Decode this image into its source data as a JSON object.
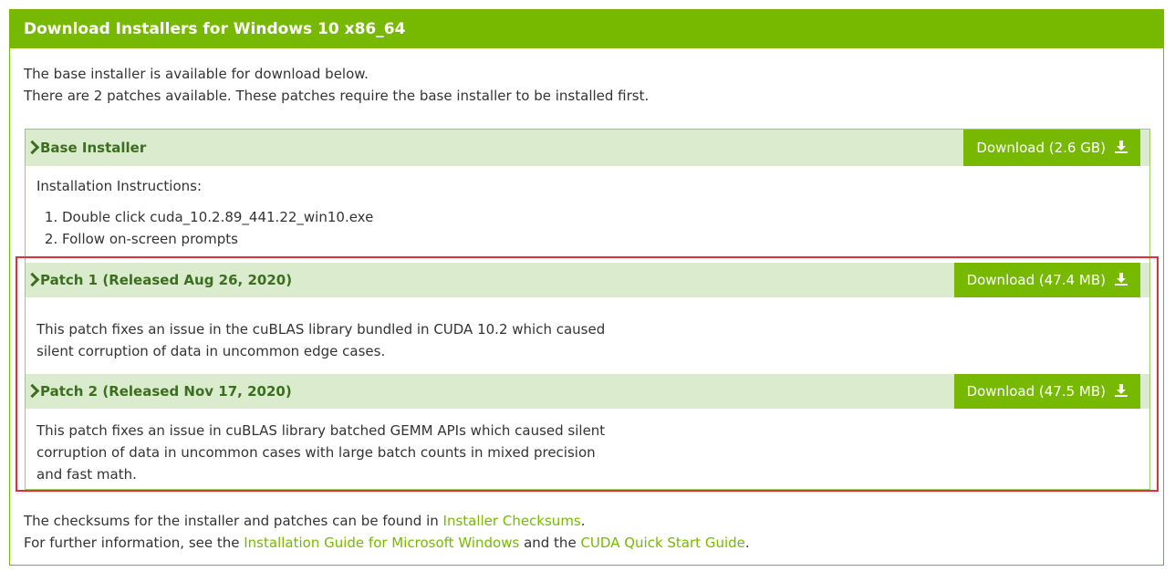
{
  "header": {
    "title": "Download Installers for Windows 10 x86_64"
  },
  "intro": {
    "line1": "The base installer is available for download below.",
    "line2": "There are 2 patches available. These patches require the base installer to be installed first."
  },
  "sections": [
    {
      "title": "Base Installer",
      "button": "Download (2.6 GB)",
      "instructions_label": "Installation Instructions:",
      "steps": [
        "Double click cuda_10.2.89_441.22_win10.exe",
        "Follow on-screen prompts"
      ]
    },
    {
      "title": "Patch 1 (Released Aug 26, 2020)",
      "button": "Download (47.4 MB)",
      "description": [
        "This patch fixes an issue in the cuBLAS library bundled in CUDA 10.2 which caused",
        "silent corruption of data in uncommon edge cases."
      ]
    },
    {
      "title": "Patch 2 (Released Nov 17, 2020)",
      "button": "Download (47.5 MB)",
      "description": [
        "This patch fixes an issue in cuBLAS library batched GEMM APIs which caused silent",
        "corruption of data in uncommon cases with large batch counts in mixed precision",
        "and fast math."
      ]
    }
  ],
  "footer": {
    "line1_prefix": "The checksums for the installer and patches can be found in ",
    "line1_link": "Installer Checksums",
    "line1_suffix": ".",
    "line2_prefix": "For further information, see the ",
    "line2_link1": "Installation Guide for Microsoft Windows",
    "line2_mid": " and the ",
    "line2_link2": "CUDA Quick Start Guide",
    "line2_suffix": "."
  },
  "icons": {
    "expand": "chevron-right-icon",
    "download": "download-icon"
  },
  "colors": {
    "accent": "#76b900",
    "section_bg": "#daeccd",
    "title_text": "#3c6e1f",
    "highlight": "#e0303a"
  }
}
